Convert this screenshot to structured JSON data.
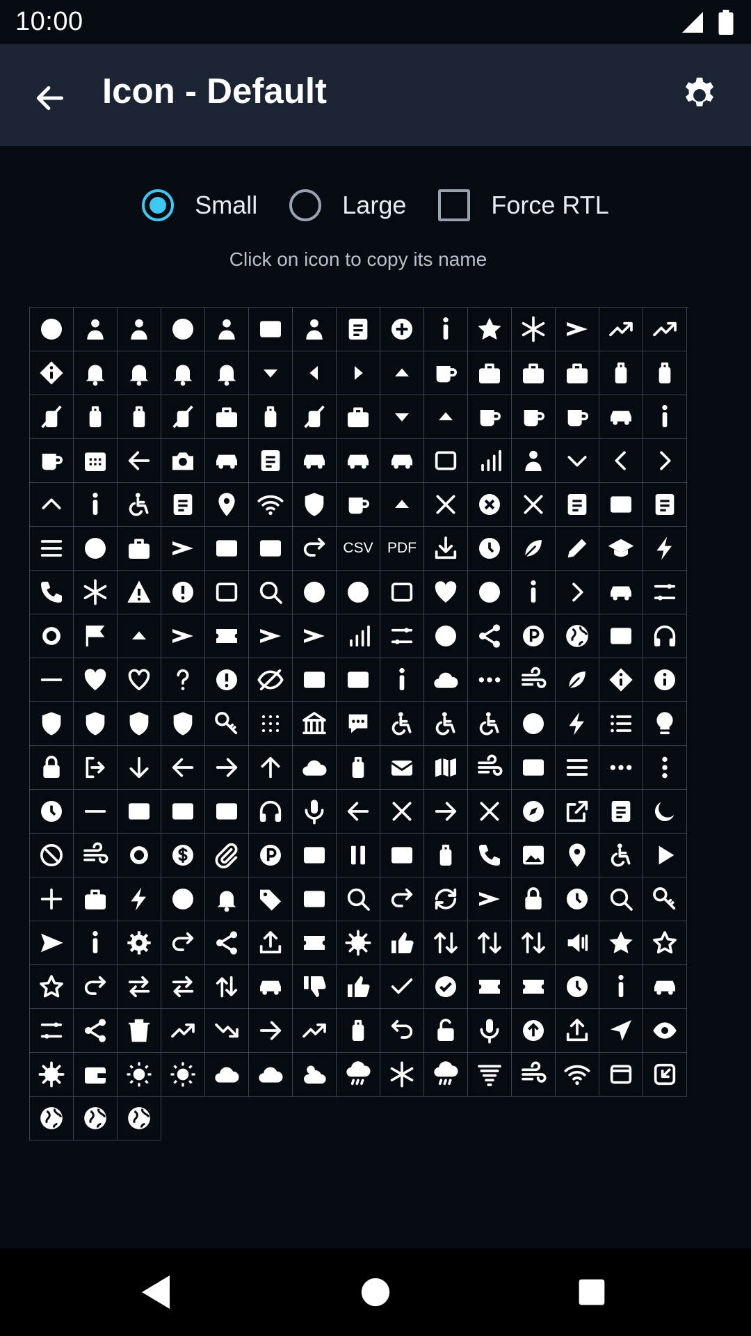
{
  "status_bar": {
    "time": "10:00",
    "icons": [
      "signal-icon",
      "battery-icon"
    ]
  },
  "app_bar": {
    "title": "Icon - Default",
    "back_icon": "arrow-back-icon",
    "settings_icon": "gear-icon"
  },
  "options": [
    {
      "label": "Small",
      "type": "radio",
      "checked": true
    },
    {
      "label": "Large",
      "type": "radio",
      "checked": false
    },
    {
      "label": "Force RTL",
      "type": "checkbox",
      "checked": false
    }
  ],
  "hint": "Click on icon to copy its name",
  "colors": {
    "background": "#060b12",
    "app_bar": "#1a2433",
    "accent": "#3ec8f2",
    "grid_line": "#3a4452",
    "icon": "#ffffff"
  },
  "icons": [
    "accessibility",
    "person-upload",
    "person-add",
    "account-circle",
    "person",
    "id-card",
    "person-card",
    "bookmark-check",
    "add-circle",
    "person-standing",
    "sparkles",
    "snowflake",
    "airplane",
    "slope-up",
    "slope-double",
    "airplane-diamond",
    "alarm-ring",
    "bell-add",
    "bell-off",
    "bell-slash",
    "caret-down",
    "caret-left",
    "caret-right",
    "caret-up",
    "trophy-cup",
    "shopping-cart",
    "bag",
    "bag-add",
    "luggage",
    "luggage-add",
    "luggage-off",
    "luggage",
    "luggage-add",
    "luggage-off",
    "bag-remove",
    "luggage-double",
    "bag-off",
    "bag-check",
    "cocktail",
    "umbrella-beach",
    "coffee-mug",
    "mug-remove",
    "mug-check",
    "car-front",
    "person-walking",
    "coffee",
    "calendar",
    "exit-left",
    "camera",
    "car-rental",
    "ticket-folder",
    "car-sharing",
    "car",
    "car-repair",
    "car-scan",
    "signal-bars",
    "person-desk",
    "chevron-down",
    "chevron-left",
    "chevron-right",
    "chevron-up",
    "person-minimal",
    "seat",
    "building",
    "location-pin",
    "rss-fan",
    "shield-star",
    "trophy",
    "hanger",
    "close",
    "close-circle",
    "compress",
    "copy",
    "star-box",
    "document-lines",
    "database",
    "pie-chart",
    "archive",
    "departure-board",
    "device-tablet",
    "laptop",
    "forward",
    "csv",
    "pdf",
    "download",
    "timer-circle",
    "eco-leaf",
    "edit-pencil",
    "graduation-cap",
    "ev-charge",
    "phone-end",
    "asterisk",
    "warning",
    "error",
    "fullscreen",
    "search-globe",
    "face-neutral",
    "face-happy",
    "face-scan",
    "hand-wave",
    "face-sad",
    "family",
    "fast-forward",
    "ferry",
    "filters",
    "fingerprint",
    "flag",
    "flask",
    "flight-off",
    "flight-exchange",
    "flight-landing",
    "flight-takeoff",
    "restaurant",
    "sliders-vertical",
    "bubble-dots",
    "fork",
    "parking-p",
    "globe",
    "dashboard",
    "headphones",
    "fitness",
    "heart",
    "heart-outline",
    "help",
    "help-circle",
    "eye-off",
    "hotel-exchange",
    "bed",
    "person-run",
    "cake",
    "paw",
    "hot-tub",
    "spa",
    "info-diamond",
    "info",
    "shield-person",
    "shield-exclamation",
    "shield-question",
    "shield-half",
    "key",
    "dots-grid",
    "bank",
    "message-dots",
    "seat-recline",
    "seat-right",
    "seat-left",
    "soccer-ball",
    "lightning",
    "list",
    "lightbulb",
    "lock",
    "logout",
    "arrow-down",
    "arrow-left",
    "arrow-right",
    "arrow-up",
    "hat-cap",
    "lounge",
    "mail",
    "map",
    "air-vent",
    "monitor-play",
    "menu",
    "more-horizontal",
    "more-vertical",
    "timer",
    "minus",
    "phone-mobile",
    "atm",
    "gift-card",
    "headset",
    "mic-off",
    "arrow-left-thin",
    "close-thin",
    "arrow-right-thin",
    "close-x",
    "compass",
    "open-external",
    "news",
    "moon",
    "block",
    "spa-hot",
    "circle-outline",
    "money",
    "attachment",
    "parking",
    "badge-person",
    "pause",
    "credit-card",
    "fuel",
    "phone",
    "image",
    "pin",
    "wheelchair",
    "play",
    "add",
    "backpack",
    "power-plug",
    "mask",
    "notification",
    "tag",
    "printer",
    "search-zoom",
    "redo",
    "sync",
    "plane-land",
    "lock-tall",
    "clock-square",
    "search",
    "hand-key",
    "send",
    "person-upright",
    "settings",
    "share-arrow",
    "share-nodes",
    "upload-tray",
    "numbered-one",
    "ship-wheel",
    "thumbs-up-solid",
    "sort-vertical",
    "sort-down",
    "sort-up",
    "volume",
    "star",
    "star-outline",
    "star-hollow",
    "route",
    "swap-h",
    "swap-alt",
    "swap-v",
    "taxi",
    "thumbs-down",
    "thumbs-up",
    "check",
    "check-circle",
    "ticket-flight",
    "ticket-exchange",
    "clock",
    "restroom",
    "train",
    "tune",
    "fork-route",
    "trash",
    "trend-up",
    "trend-down",
    "arrow-right-short",
    "arrow-up-right",
    "suitcase",
    "undo",
    "unlock",
    "microphone",
    "upload-circle",
    "upload",
    "navigation",
    "eye",
    "virus",
    "wallet",
    "sun",
    "sun-bright",
    "cloud",
    "cloud-solid",
    "partly-cloudy",
    "rain",
    "snow",
    "thunderstorm",
    "tornado",
    "wind",
    "wifi",
    "window",
    "import-box",
    "globe-africa",
    "globe-americas",
    "globe-asia"
  ],
  "nav_bar": [
    "nav-back-icon",
    "nav-home-icon",
    "nav-recents-icon"
  ]
}
